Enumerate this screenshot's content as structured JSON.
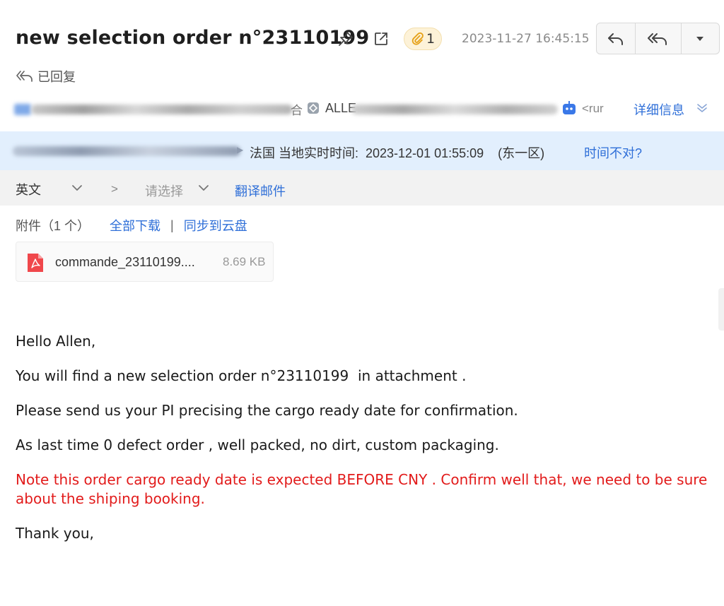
{
  "email": {
    "subject": "new selection order n°23110199",
    "attachment_count": "1",
    "date": "2023-11-27 16:45:15",
    "status": "已回复"
  },
  "sender": {
    "name_fragment": "合",
    "name_prefix": "ALLE",
    "address_fragment": "<rur",
    "details_label": "详细信息"
  },
  "timezone": {
    "text": "法国 当地实时时间:  2023-12-01 01:55:09    (东一区)",
    "link": "时间不对?"
  },
  "translate": {
    "source_lang": "英文",
    "separator": ">",
    "target_placeholder": "请选择",
    "action": "翻译邮件"
  },
  "attachments": {
    "label": "附件（1 个）",
    "download_all": "全部下载",
    "divider": "|",
    "save_cloud": "同步到云盘",
    "files": [
      {
        "name": "commande_23110199....",
        "size": "8.69 KB"
      }
    ]
  },
  "body": {
    "greeting": "Hello Allen,",
    "line1": "You will find a new selection order n°23110199  in attachment .",
    "line2": "Please send us your PI precising the cargo ready date for confirmation.",
    "line3": "As last time 0 defect order , well packed, no dirt, custom packaging.",
    "note": "Note this order cargo ready date is expected BEFORE CNY . Confirm well that, we need to be sure about the shiping booking.",
    "closing": "Thank you,"
  },
  "colors": {
    "link": "#2f6fd8",
    "note_red": "#e21b1b",
    "timezone_band": "#e2effd"
  }
}
